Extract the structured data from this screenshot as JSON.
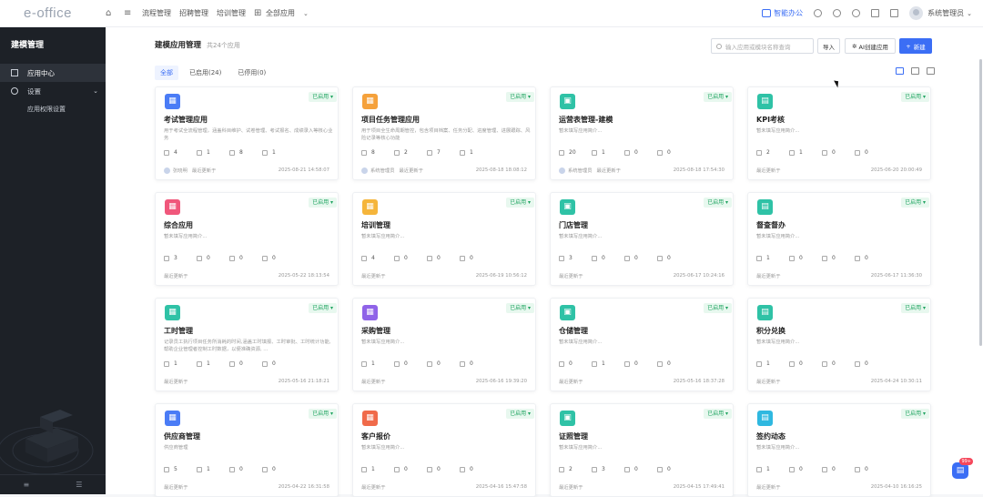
{
  "topbar": {
    "logo": "e-office",
    "nav": [
      "流程管理",
      "招聘管理",
      "培训管理",
      "全部应用"
    ],
    "smart": "智能办公",
    "user": "系统管理员"
  },
  "sidebar": {
    "title": "建模管理",
    "items": [
      {
        "label": "应用中心",
        "icon": "grid-icon"
      },
      {
        "label": "设置",
        "icon": "settings-icon"
      },
      {
        "label": "应用权限设置",
        "icon": ""
      }
    ]
  },
  "main": {
    "title": "建模应用管理",
    "count": "共24个应用",
    "search_placeholder": "输入应用或模块名称查询",
    "import": "导入",
    "ai_create": "AI创建应用",
    "new": "新建",
    "tabs": [
      "全部",
      "已启用(24)",
      "已停用(0)"
    ]
  },
  "status_label": "已启用",
  "colors": {
    "accent": "#3b6ef5",
    "enabled": "#20a460"
  },
  "cards": [
    {
      "title": "考试管理应用",
      "desc": "用于考试全流程管理，涵盖科目维护、试卷管理、考试报名、成绩录入等核心业务",
      "icon_color": "#4a7cf6",
      "stats": [
        "4",
        "1",
        "8",
        "1"
      ],
      "user": "张晓明",
      "updated": "最近更新于",
      "time": "2025-08-21 14:58:07"
    },
    {
      "title": "项目任务管理应用",
      "desc": "用于项目全生命周期管控，包含项目档案、任务分配、进度管理、进展跟踪、风险记录等核心功能",
      "icon_color": "#f5a13b",
      "stats": [
        "8",
        "2",
        "7",
        "1"
      ],
      "user": "系统管理员",
      "updated": "最近更新于",
      "time": "2025-08-18 18:08:12"
    },
    {
      "title": "运营表管理-建模",
      "desc": "暂未填写应用简介...",
      "icon_color": "#2fc2a6",
      "stats": [
        "20",
        "1",
        "0",
        "0"
      ],
      "user": "系统管理员",
      "updated": "最近更新于",
      "time": "2025-08-18 17:54:30"
    },
    {
      "title": "KPI考核",
      "desc": "暂未填写应用简介...",
      "icon_color": "#2fc2a6",
      "stats": [
        "2",
        "1",
        "0",
        "0"
      ],
      "user": "",
      "updated": "最近更新于",
      "time": "2025-06-20 20:00:49"
    },
    {
      "title": "综合应用",
      "desc": "暂未填写应用简介...",
      "icon_color": "#f0577b",
      "stats": [
        "3",
        "0",
        "0",
        "0"
      ],
      "user": "",
      "updated": "最近更新于",
      "time": "2025-05-22 18:13:54"
    },
    {
      "title": "培训管理",
      "desc": "暂未填写应用简介...",
      "icon_color": "#f5b53b",
      "stats": [
        "4",
        "0",
        "0",
        "0"
      ],
      "user": "",
      "updated": "最近更新于",
      "time": "2025-06-19 10:56:12"
    },
    {
      "title": "门店管理",
      "desc": "暂未填写应用简介...",
      "icon_color": "#2fc2a6",
      "stats": [
        "3",
        "0",
        "0",
        "0"
      ],
      "user": "",
      "updated": "最近更新于",
      "time": "2025-06-17 10:24:16"
    },
    {
      "title": "督查督办",
      "desc": "暂未填写应用简介...",
      "icon_color": "#2fc2a6",
      "stats": [
        "1",
        "0",
        "0",
        "0"
      ],
      "user": "",
      "updated": "最近更新于",
      "time": "2025-06-17 11:36:30"
    },
    {
      "title": "工时管理",
      "desc": "记录员工执行项目任务所消耗的时间,涵盖工时填报、工时审批、工时统计功能,帮助企业管理者控制工时数据，以便准确资源, ...",
      "icon_color": "#2fc2a6",
      "stats": [
        "1",
        "1",
        "0",
        "0"
      ],
      "user": "",
      "updated": "最近更新于",
      "time": "2025-05-16 21:18:21"
    },
    {
      "title": "采购管理",
      "desc": "暂未填写应用简介...",
      "icon_color": "#8f63e8",
      "stats": [
        "1",
        "0",
        "0",
        "0"
      ],
      "user": "",
      "updated": "最近更新于",
      "time": "2025-06-16 19:39:20"
    },
    {
      "title": "仓储管理",
      "desc": "暂未填写应用简介...",
      "icon_color": "#2fc2a6",
      "stats": [
        "0",
        "1",
        "0",
        "0"
      ],
      "user": "",
      "updated": "最近更新于",
      "time": "2025-05-16 18:37:28"
    },
    {
      "title": "积分兑换",
      "desc": "暂未填写应用简介...",
      "icon_color": "#2fc2a6",
      "stats": [
        "1",
        "0",
        "0",
        "0"
      ],
      "user": "",
      "updated": "最近更新于",
      "time": "2025-04-24 10:30:11"
    },
    {
      "title": "供应商管理",
      "desc": "供应商管理",
      "icon_color": "#4a7cf6",
      "stats": [
        "5",
        "1",
        "0",
        "0"
      ],
      "user": "",
      "updated": "最近更新于",
      "time": "2025-04-22 16:31:58"
    },
    {
      "title": "客户报价",
      "desc": "暂未填写应用简介...",
      "icon_color": "#f06a4a",
      "stats": [
        "1",
        "0",
        "0",
        "0"
      ],
      "user": "",
      "updated": "最近更新于",
      "time": "2025-04-16 15:47:58"
    },
    {
      "title": "证照管理",
      "desc": "暂未填写应用简介...",
      "icon_color": "#2fc2a6",
      "stats": [
        "2",
        "3",
        "0",
        "0"
      ],
      "user": "",
      "updated": "最近更新于",
      "time": "2025-04-15 17:49:41"
    },
    {
      "title": "签约动态",
      "desc": "暂未填写应用简介...",
      "icon_color": "#2fb8e0",
      "stats": [
        "1",
        "0",
        "0",
        "0"
      ],
      "user": "",
      "updated": "最近更新于",
      "time": "2025-04-10 16:16:25"
    }
  ],
  "chat_badge": "99+"
}
